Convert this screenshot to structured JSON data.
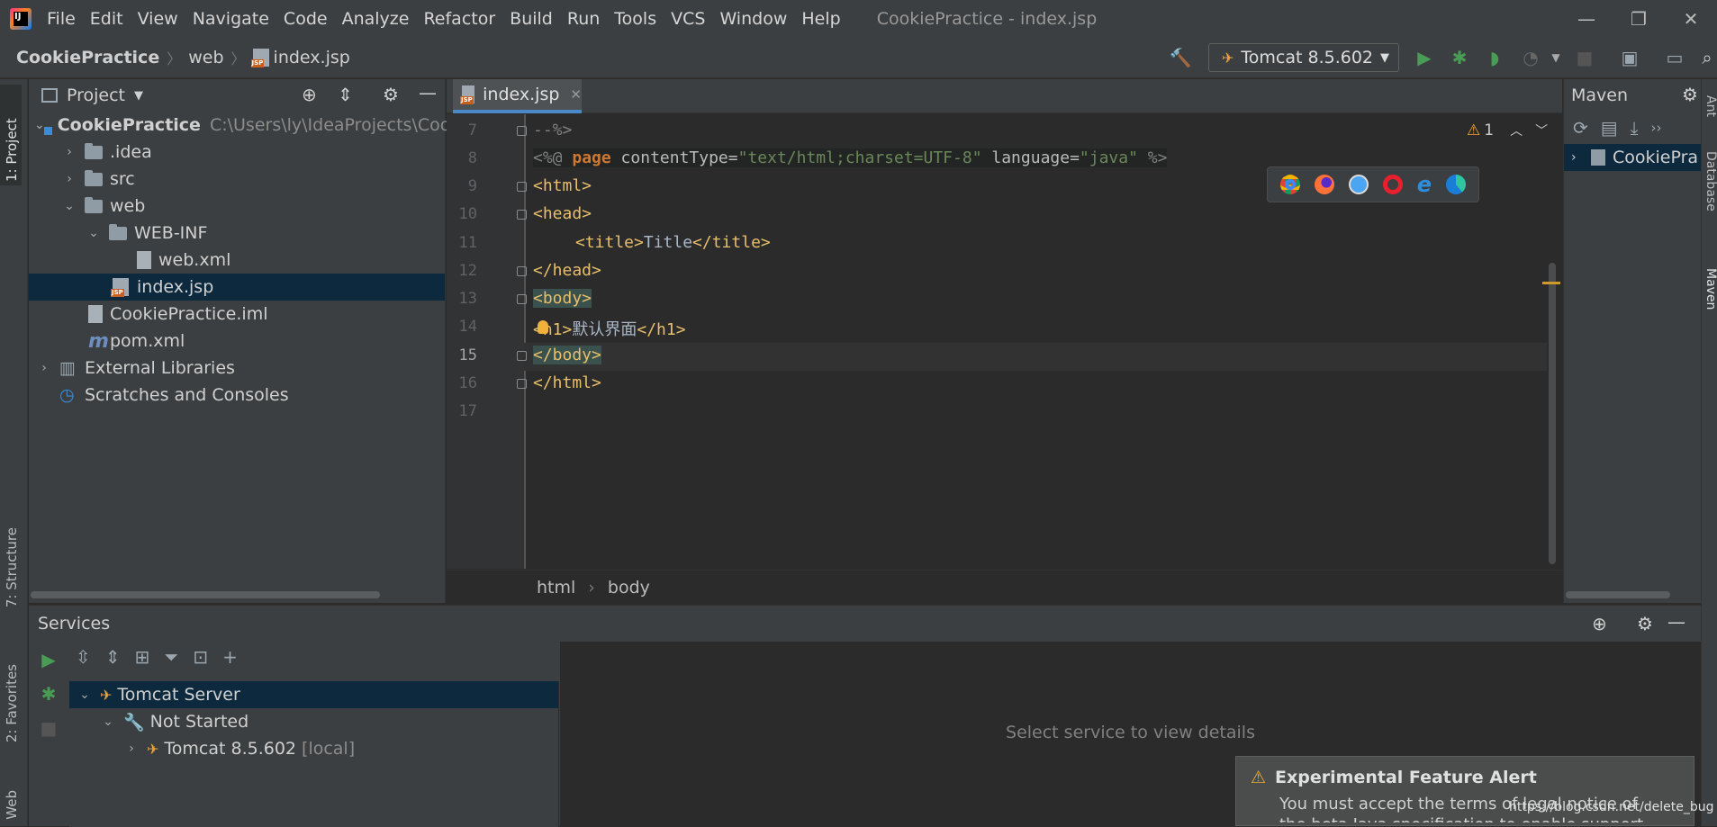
{
  "titlebar": {
    "menu": [
      "File",
      "Edit",
      "View",
      "Navigate",
      "Code",
      "Analyze",
      "Refactor",
      "Build",
      "Run",
      "Tools",
      "VCS",
      "Window",
      "Help"
    ],
    "window_title": "CookiePractice - index.jsp"
  },
  "navbar": {
    "project": "CookiePractice",
    "folder": "web",
    "file": "index.jsp",
    "run_config": "Tomcat 8.5.602"
  },
  "left_stripe": {
    "project": "1: Project",
    "structure": "7: Structure",
    "favorites": "2: Favorites",
    "web": "Web"
  },
  "right_stripe": {
    "ant": "Ant",
    "database": "Database",
    "maven": "Maven"
  },
  "project_panel": {
    "title": "Project",
    "root_name": "CookiePractice",
    "root_path": "C:\\Users\\ly\\IdeaProjects\\Cook",
    "items": {
      "idea": ".idea",
      "src": "src",
      "web": "web",
      "webinf": "WEB-INF",
      "webxml": "web.xml",
      "indexjsp": "index.jsp",
      "iml": "CookiePractice.iml",
      "pom": "pom.xml",
      "extlib": "External Libraries",
      "scratches": "Scratches and Consoles"
    }
  },
  "editor": {
    "tab": "index.jsp",
    "warnings": "1",
    "lines": {
      "n7": "7",
      "n8": "8",
      "n9": "9",
      "n10": "10",
      "n11": "11",
      "n12": "12",
      "n13": "13",
      "n14": "14",
      "n15": "15",
      "n16": "16",
      "n17": "17"
    },
    "code": {
      "l7": "--%>",
      "l8_a": "<%@ ",
      "l8_page": "page",
      "l8_ct": " contentType=",
      "l8_ctv": "\"text/html;charset=UTF-8\"",
      "l8_lang": " language=",
      "l8_langv": "\"java\"",
      "l8_end": " %>",
      "l9": "<html>",
      "l10": "<head>",
      "l11_open": "<title>",
      "l11_text": "Title",
      "l11_close": "</title>",
      "l12": "</head>",
      "l13": "<body>",
      "l14_open": "<h1>",
      "l14_text": "默认界面",
      "l14_close": "</h1>",
      "l15": "</body>",
      "l16": "</html>"
    },
    "breadcrumb": [
      "html",
      "body"
    ]
  },
  "maven": {
    "title": "Maven",
    "item": "CookiePra"
  },
  "services": {
    "title": "Services",
    "tomcat_server": "Tomcat Server",
    "not_started": "Not Started",
    "instance": "Tomcat 8.5.602",
    "instance_tag": "[local]",
    "empty_message": "Select service to view details"
  },
  "alert": {
    "title": "Experimental Feature Alert",
    "body_1": "You must accept the terms of legal notice of",
    "body_2": "the beta Java specification to enable support"
  },
  "watermark": "https://blog.csdn.net/delete_bug",
  "colors": {
    "accent": "#4a88c7",
    "run_green": "#499c54",
    "tag_yellow": "#e8bf6a",
    "keyword": "#cc7832",
    "string": "#6a8759"
  }
}
